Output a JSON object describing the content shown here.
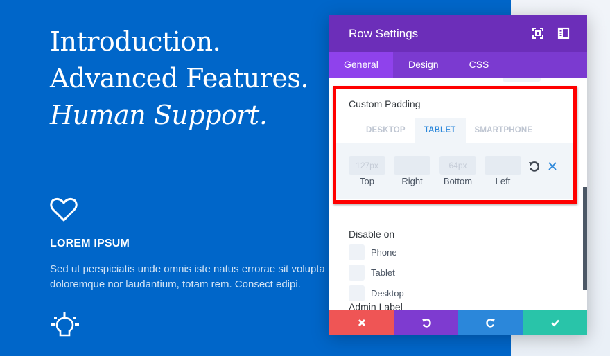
{
  "page": {
    "hero_lines": [
      "Introduction.",
      "Advanced Features.",
      "Human Support."
    ],
    "feature": {
      "icon": "heart-icon",
      "title": "LOREM IPSUM",
      "text_lines": [
        "Sed ut perspiciatis unde omnis iste natus errorae sit volupta",
        "doloremque nor laudantium, totam rem. Consect edipi."
      ]
    },
    "second_feature_icon": "lightbulb-icon",
    "colors": {
      "background_blue": "#0066c9",
      "background_light": "#eef2f7"
    }
  },
  "modal": {
    "title": "Row Settings",
    "header_icons": [
      "expand-icon",
      "sidebar-layout-icon"
    ],
    "tabs": [
      {
        "label": "General",
        "active": true
      },
      {
        "label": "Design",
        "active": false
      },
      {
        "label": "CSS",
        "active": false
      }
    ],
    "custom_padding": {
      "label": "Custom Padding",
      "device_tabs": [
        {
          "label": "DESKTOP",
          "active": false
        },
        {
          "label": "TABLET",
          "active": true
        },
        {
          "label": "SMARTPHONE",
          "active": false
        }
      ],
      "fields": [
        {
          "label": "Top",
          "value": "",
          "placeholder": "127px"
        },
        {
          "label": "Right",
          "value": "",
          "placeholder": ""
        },
        {
          "label": "Bottom",
          "value": "",
          "placeholder": "64px"
        },
        {
          "label": "Left",
          "value": "",
          "placeholder": ""
        }
      ],
      "reset_icon": "reset-icon",
      "clear_icon": "close-icon"
    },
    "disable_on": {
      "label": "Disable on",
      "options": [
        {
          "label": "Phone",
          "checked": false
        },
        {
          "label": "Tablet",
          "checked": false
        },
        {
          "label": "Desktop",
          "checked": false
        }
      ]
    },
    "admin_label": "Admin Label",
    "footer": {
      "cancel_icon": "close-icon",
      "undo_icon": "undo-icon",
      "redo_icon": "redo-icon",
      "save_icon": "checkmark-icon"
    },
    "colors": {
      "header": "#6c2eb9",
      "tabs": "#7b3ad0",
      "active_tab": "#8f42ec",
      "accent": "#2b87da",
      "highlight": "#ff0000",
      "cancel": "#ef5555",
      "undo": "#7e3bd0",
      "redo": "#2b87da",
      "save": "#29c4a9"
    }
  }
}
